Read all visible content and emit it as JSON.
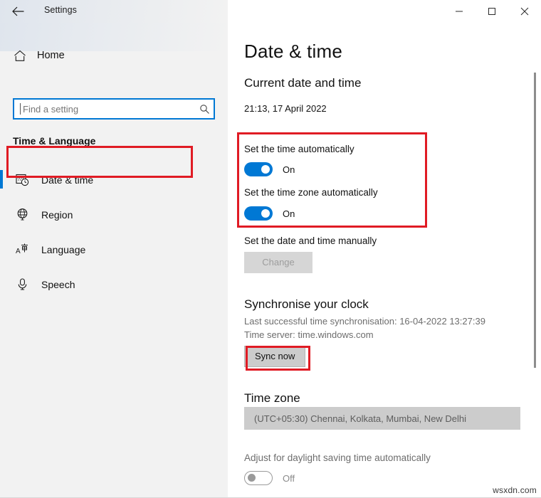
{
  "titlebar": {
    "back_icon": "back-arrow-icon",
    "title": "Settings",
    "minimize_label": "–",
    "maximize_label": "□",
    "close_label": "✕"
  },
  "sidebar": {
    "home": {
      "label": "Home",
      "icon": "home-icon"
    },
    "search": {
      "value": "",
      "placeholder": "Find a setting",
      "icon": "search-icon"
    },
    "category": "Time & Language",
    "items": [
      {
        "label": "Date & time",
        "icon": "calendar-clock-icon",
        "selected": true
      },
      {
        "label": "Region",
        "icon": "globe-icon",
        "selected": false
      },
      {
        "label": "Language",
        "icon": "language-icon",
        "selected": false
      },
      {
        "label": "Speech",
        "icon": "microphone-icon",
        "selected": false
      }
    ]
  },
  "main": {
    "page_title": "Date & time",
    "current": {
      "heading": "Current date and time",
      "value": "21:13, 17 April 2022"
    },
    "set_time_auto": {
      "label": "Set the time automatically",
      "state": "On"
    },
    "set_timezone_auto": {
      "label": "Set the time zone automatically",
      "state": "On"
    },
    "manual": {
      "label": "Set the date and time manually",
      "button": "Change"
    },
    "sync": {
      "heading": "Synchronise your clock",
      "last_sync": "Last successful time synchronisation: 16-04-2022 13:27:39",
      "time_server": "Time server: time.windows.com",
      "button": "Sync now"
    },
    "timezone": {
      "heading": "Time zone",
      "selected": "(UTC+05:30) Chennai, Kolkata, Mumbai, New Delhi"
    },
    "dst": {
      "label": "Adjust for daylight saving time automatically",
      "state": "Off"
    }
  },
  "annotations": {
    "highlight_color": "#e01b24",
    "accent_color": "#0078d4",
    "boxes": [
      "date-time-sidebar-item",
      "auto-time-toggles",
      "sync-now-button"
    ]
  },
  "watermark": "wsxdn.com"
}
